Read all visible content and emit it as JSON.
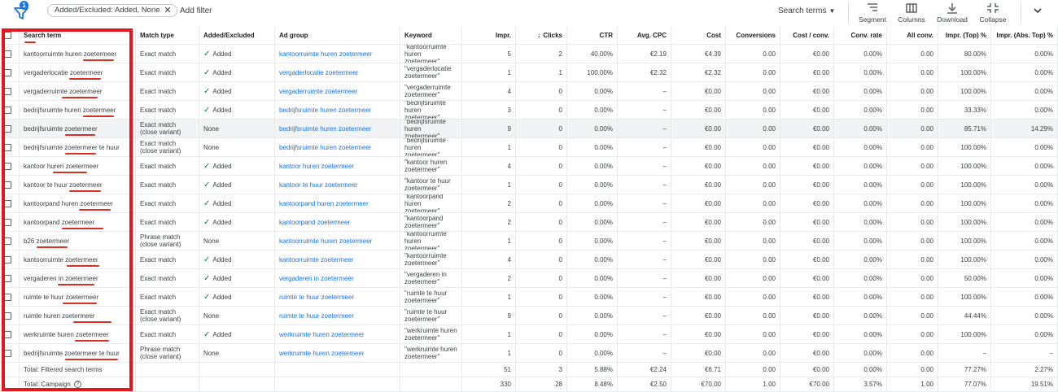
{
  "toolbar": {
    "filter_badge": "1",
    "chip_label": "Added/Excluded: Added, None",
    "chip_close": "✕",
    "add_filter": "Add filter",
    "view_select": "Search terms",
    "segment": "Segment",
    "columns": "Columns",
    "download": "Download",
    "collapse": "Collapse"
  },
  "columns": {
    "search_term": "Search term",
    "match_type": "Match type",
    "added_excluded": "Added/Excluded",
    "ad_group": "Ad group",
    "keyword": "Keyword",
    "impr": "Impr.",
    "clicks": "Clicks",
    "ctr": "CTR",
    "avg_cpc": "Avg. CPC",
    "cost": "Cost",
    "conversions": "Conversions",
    "cost_conv": "Cost / conv.",
    "conv_rate": "Conv. rate",
    "all_conv": "All conv.",
    "impr_top": "Impr. (Top) %",
    "impr_abs_top": "Impr. (Abs. Top) %"
  },
  "rows": [
    {
      "term": "kantoorruimte huren zoetermeer",
      "match": "Exact match",
      "status": "Added",
      "ad_group": "kantoorruimte huren zoetermeer",
      "keyword": "\"kantoorruimte huren zoetermeer\"",
      "impr": "5",
      "clicks": "2",
      "ctr": "40.00%",
      "cpc": "€2.19",
      "cost": "€4.39",
      "conv": "0.00",
      "cost_conv": "€0.00",
      "conv_rate": "0.00%",
      "all_conv": "0.00",
      "top": "80.00%",
      "abs_top": "0.00%"
    },
    {
      "term": "vergaderlocatie zoetermeer",
      "match": "Exact match",
      "status": "Added",
      "ad_group": "vergaderlocatie zoetermeer",
      "keyword": "\"vergaderlocatie zoetermeer\"",
      "impr": "1",
      "clicks": "1",
      "ctr": "100.00%",
      "cpc": "€2.32",
      "cost": "€2.32",
      "conv": "0.00",
      "cost_conv": "€0.00",
      "conv_rate": "0.00%",
      "all_conv": "0.00",
      "top": "100.00%",
      "abs_top": "0.00%"
    },
    {
      "term": "vergaderruimte zoetermeer",
      "match": "Exact match",
      "status": "Added",
      "ad_group": "vergaderruimte zoetermeer",
      "keyword": "\"vergaderruimte zoetermeer\"",
      "impr": "4",
      "clicks": "0",
      "ctr": "0.00%",
      "cpc": "–",
      "cost": "€0.00",
      "conv": "0.00",
      "cost_conv": "€0.00",
      "conv_rate": "0.00%",
      "all_conv": "0.00",
      "top": "100.00%",
      "abs_top": "0.00%"
    },
    {
      "term": "bedrijfsruimte huren zoetermeer",
      "match": "Exact match",
      "status": "Added",
      "ad_group": "bedrijfsruimte huren zoetermeer",
      "keyword": "\"bedrijfsruimte huren zoetermeer\"",
      "impr": "3",
      "clicks": "0",
      "ctr": "0.00%",
      "cpc": "–",
      "cost": "€0.00",
      "conv": "0.00",
      "cost_conv": "€0.00",
      "conv_rate": "0.00%",
      "all_conv": "0.00",
      "top": "33.33%",
      "abs_top": "0.00%"
    },
    {
      "term": "bedrijfsruimte zoetermeer",
      "match": "Exact match (close variant)",
      "status": "None",
      "ad_group": "bedrijfsruimte huren zoetermeer",
      "keyword": "\"bedrijfsruimte huren zoetermeer\"",
      "impr": "9",
      "clicks": "0",
      "ctr": "0.00%",
      "cpc": "–",
      "cost": "€0.00",
      "conv": "0.00",
      "cost_conv": "€0.00",
      "conv_rate": "0.00%",
      "all_conv": "0.00",
      "top": "85.71%",
      "abs_top": "14.29%"
    },
    {
      "term": "bedrijfsruimte zoetermeer te huur",
      "match": "Exact match (close variant)",
      "status": "None",
      "ad_group": "bedrijfsruimte huren zoetermeer",
      "keyword": "\"bedrijfsruimte huren zoetermeer\"",
      "impr": "1",
      "clicks": "0",
      "ctr": "0.00%",
      "cpc": "–",
      "cost": "€0.00",
      "conv": "0.00",
      "cost_conv": "€0.00",
      "conv_rate": "0.00%",
      "all_conv": "0.00",
      "top": "100.00%",
      "abs_top": "0.00%"
    },
    {
      "term": "kantoor huren zoetermeer",
      "match": "Exact match",
      "status": "Added",
      "ad_group": "kantoor huren zoetermeer",
      "keyword": "\"kantoor huren zoetermeer\"",
      "impr": "4",
      "clicks": "0",
      "ctr": "0.00%",
      "cpc": "–",
      "cost": "€0.00",
      "conv": "0.00",
      "cost_conv": "€0.00",
      "conv_rate": "0.00%",
      "all_conv": "0.00",
      "top": "100.00%",
      "abs_top": "0.00%"
    },
    {
      "term": "kantoor te huur zoetermeer",
      "match": "Exact match",
      "status": "Added",
      "ad_group": "kantoor te huur zoetermeer",
      "keyword": "\"kantoor te huur zoetermeer\"",
      "impr": "1",
      "clicks": "0",
      "ctr": "0.00%",
      "cpc": "–",
      "cost": "€0.00",
      "conv": "0.00",
      "cost_conv": "€0.00",
      "conv_rate": "0.00%",
      "all_conv": "0.00",
      "top": "100.00%",
      "abs_top": "0.00%"
    },
    {
      "term": "kantoorpand huren zoetermeer",
      "match": "Exact match",
      "status": "Added",
      "ad_group": "kantoorpand huren zoetermeer",
      "keyword": "\"kantoorpand huren zoetermeer\"",
      "impr": "2",
      "clicks": "0",
      "ctr": "0.00%",
      "cpc": "–",
      "cost": "€0.00",
      "conv": "0.00",
      "cost_conv": "€0.00",
      "conv_rate": "0.00%",
      "all_conv": "0.00",
      "top": "100.00%",
      "abs_top": "0.00%"
    },
    {
      "term": "kantoorpand zoetermeer",
      "match": "Exact match",
      "status": "Added",
      "ad_group": "kantoorpand zoetermeer",
      "keyword": "\"kantoorpand zoetermeer\"",
      "impr": "2",
      "clicks": "0",
      "ctr": "0.00%",
      "cpc": "–",
      "cost": "€0.00",
      "conv": "0.00",
      "cost_conv": "€0.00",
      "conv_rate": "0.00%",
      "all_conv": "0.00",
      "top": "100.00%",
      "abs_top": "0.00%"
    },
    {
      "term": "b26 zoetermeer",
      "match": "Phrase match (close variant)",
      "status": "None",
      "ad_group": "kantoorruimte huren zoetermeer",
      "keyword": "\"kantoorruimte huren zoetermeer\"",
      "impr": "1",
      "clicks": "0",
      "ctr": "0.00%",
      "cpc": "–",
      "cost": "€0.00",
      "conv": "0.00",
      "cost_conv": "€0.00",
      "conv_rate": "0.00%",
      "all_conv": "0.00",
      "top": "100.00%",
      "abs_top": "0.00%"
    },
    {
      "term": "kantoorruimte zoetermeer",
      "match": "Exact match",
      "status": "Added",
      "ad_group": "kantoorruimte zoetermeer",
      "keyword": "\"kantoorruimte zoetermeer\"",
      "impr": "4",
      "clicks": "0",
      "ctr": "0.00%",
      "cpc": "–",
      "cost": "€0.00",
      "conv": "0.00",
      "cost_conv": "€0.00",
      "conv_rate": "0.00%",
      "all_conv": "0.00",
      "top": "100.00%",
      "abs_top": "0.00%"
    },
    {
      "term": "vergaderen in zoetermeer",
      "match": "Exact match",
      "status": "Added",
      "ad_group": "vergaderen in zoetermeer",
      "keyword": "\"vergaderen in zoetermeer\"",
      "impr": "2",
      "clicks": "0",
      "ctr": "0.00%",
      "cpc": "–",
      "cost": "€0.00",
      "conv": "0.00",
      "cost_conv": "€0.00",
      "conv_rate": "0.00%",
      "all_conv": "0.00",
      "top": "50.00%",
      "abs_top": "0.00%"
    },
    {
      "term": "ruimte te huur zoetermeer",
      "match": "Exact match",
      "status": "Added",
      "ad_group": "ruimte te huur zoetermeer",
      "keyword": "\"ruimte te huur zoetermeer\"",
      "impr": "1",
      "clicks": "0",
      "ctr": "0.00%",
      "cpc": "–",
      "cost": "€0.00",
      "conv": "0.00",
      "cost_conv": "€0.00",
      "conv_rate": "0.00%",
      "all_conv": "0.00",
      "top": "100.00%",
      "abs_top": "0.00%"
    },
    {
      "term": "ruimte huren zoetermeer",
      "match": "Exact match (close variant)",
      "status": "None",
      "ad_group": "ruimte te huur zoetermeer",
      "keyword": "\"ruimte te huur zoetermeer\"",
      "impr": "9",
      "clicks": "0",
      "ctr": "0.00%",
      "cpc": "–",
      "cost": "€0.00",
      "conv": "0.00",
      "cost_conv": "€0.00",
      "conv_rate": "0.00%",
      "all_conv": "0.00",
      "top": "44.44%",
      "abs_top": "0.00%"
    },
    {
      "term": "werkruimte huren zoetermeer",
      "match": "Exact match",
      "status": "Added",
      "ad_group": "werkruimte huren zoetermeer",
      "keyword": "\"werkruimte huren zoetermeer\"",
      "impr": "1",
      "clicks": "0",
      "ctr": "0.00%",
      "cpc": "–",
      "cost": "€0.00",
      "conv": "0.00",
      "cost_conv": "€0.00",
      "conv_rate": "0.00%",
      "all_conv": "0.00",
      "top": "100.00%",
      "abs_top": "0.00%"
    },
    {
      "term": "bedrijfsruimte zoetermeer te huur",
      "match": "Phrase match (close variant)",
      "status": "None",
      "ad_group": "werkruimte huren zoetermeer",
      "keyword": "\"werkruimte huren zoetermeer\"",
      "impr": "1",
      "clicks": "0",
      "ctr": "0.00%",
      "cpc": "–",
      "cost": "€0.00",
      "conv": "0.00",
      "cost_conv": "€0.00",
      "conv_rate": "0.00%",
      "all_conv": "0.00",
      "top": "–",
      "abs_top": "–"
    }
  ],
  "totals": [
    {
      "label": "Total: Filtered search terms",
      "impr": "51",
      "clicks": "3",
      "ctr": "5.88%",
      "cpc": "€2.24",
      "cost": "€6.71",
      "conv": "0.00",
      "cost_conv": "€0.00",
      "conv_rate": "0.00%",
      "all_conv": "0.00",
      "top": "77.27%",
      "abs_top": "2.27%",
      "help": false
    },
    {
      "label": "Total: Campaign",
      "impr": "330",
      "clicks": "28",
      "ctr": "8.48%",
      "cpc": "€2.50",
      "cost": "€70.00",
      "conv": "1.00",
      "cost_conv": "€70.00",
      "conv_rate": "3.57%",
      "all_conv": "1.00",
      "top": "77.07%",
      "abs_top": "19.51%",
      "help": true
    }
  ],
  "colors": {
    "accent": "#1a73e8",
    "added": "#188038",
    "annotation": "#e3171e"
  },
  "icons": [
    "filter-icon",
    "close-icon",
    "caret-down-icon",
    "segment-icon",
    "columns-icon",
    "download-icon",
    "collapse-icon",
    "chevron-down-icon",
    "check-icon",
    "sort-down-arrow-icon",
    "help-icon"
  ]
}
